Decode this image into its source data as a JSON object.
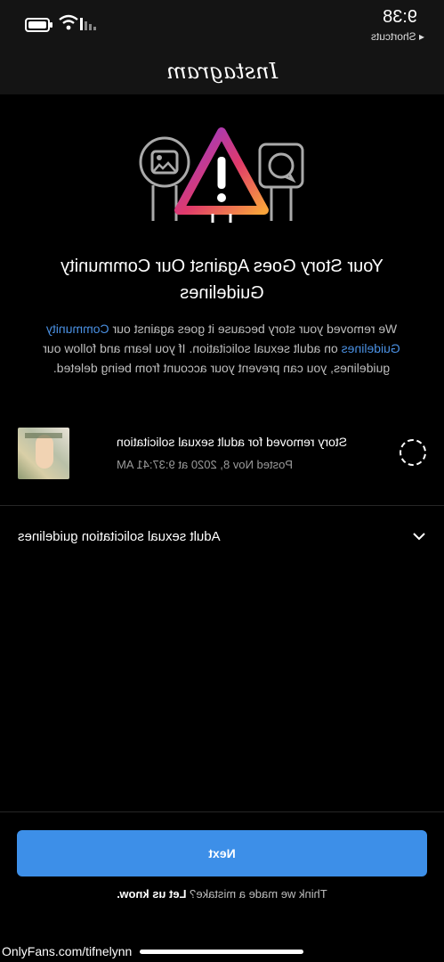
{
  "status": {
    "time": "9:38",
    "back_app": "◂ Shortcuts"
  },
  "header": {
    "logo": "Instagram"
  },
  "notice": {
    "title": "Your Story Goes Against Our Community Guidelines",
    "desc_before": "We removed your story because it goes against our ",
    "desc_link": "Community Guidelines",
    "desc_after": " on adult sexual solicitation. If you learn and follow our guidelines, you can prevent your account from being deleted."
  },
  "story": {
    "title": "Story removed for adult sexual solicitation",
    "date": "Posted Nov 8, 2020 at 9:37:41 AM"
  },
  "accordion": {
    "label": "Adult sexual solicitation guidelines"
  },
  "footer": {
    "next_label": "Next",
    "mistake_text": "Think we made a mistake? ",
    "mistake_link": "Let us know."
  },
  "watermark": "OnlyFans.com/tifnelynn",
  "colors": {
    "accent": "#3d8fe8",
    "link": "#4a90e2",
    "background": "#000000"
  },
  "icons": [
    "battery-icon",
    "wifi-icon",
    "signal-icon",
    "image-icon",
    "chat-bubble-icon",
    "warning-triangle-icon",
    "spinner-icon",
    "chevron-down-icon"
  ]
}
